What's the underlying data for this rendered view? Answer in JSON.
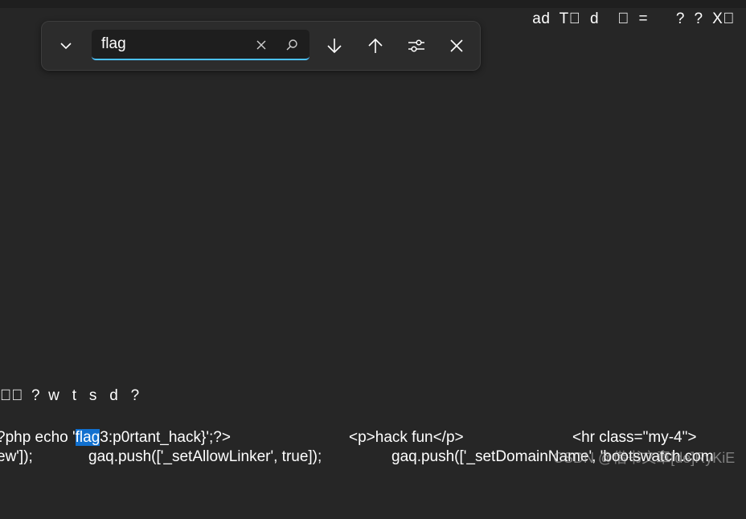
{
  "top_garbled_text": "ad  T\u0000  d    \u0000  =      ?  ?  X\u0000",
  "find_widget": {
    "search_value": "flag",
    "toggle_icon": "chevron-down-icon",
    "clear_icon": "close-icon",
    "search_icon": "search-icon",
    "next_icon": "arrow-down-icon",
    "prev_icon": "arrow-up-icon",
    "filter_icon": "sliders-icon",
    "close_icon": "close-icon"
  },
  "status_line": "\u0000\u0000  ?  w   t   s   d   ?",
  "code": {
    "line1_prefix": "?php echo '",
    "line1_match": "flag",
    "line1_suffix": "3:p0rtant_hack}';?>",
    "line1_mid": "<p>hack fun</p>",
    "line1_right": "<hr class=\"my-4\">",
    "line2_a": "ew']);",
    "line2_b": "gaq.push(['_setAllowLinker', true]);",
    "line2_c": "gaq.push(['_setDomainName', 'bootswatch.com"
  },
  "watermark": "CSDN @借书文章[de]RyKiE"
}
